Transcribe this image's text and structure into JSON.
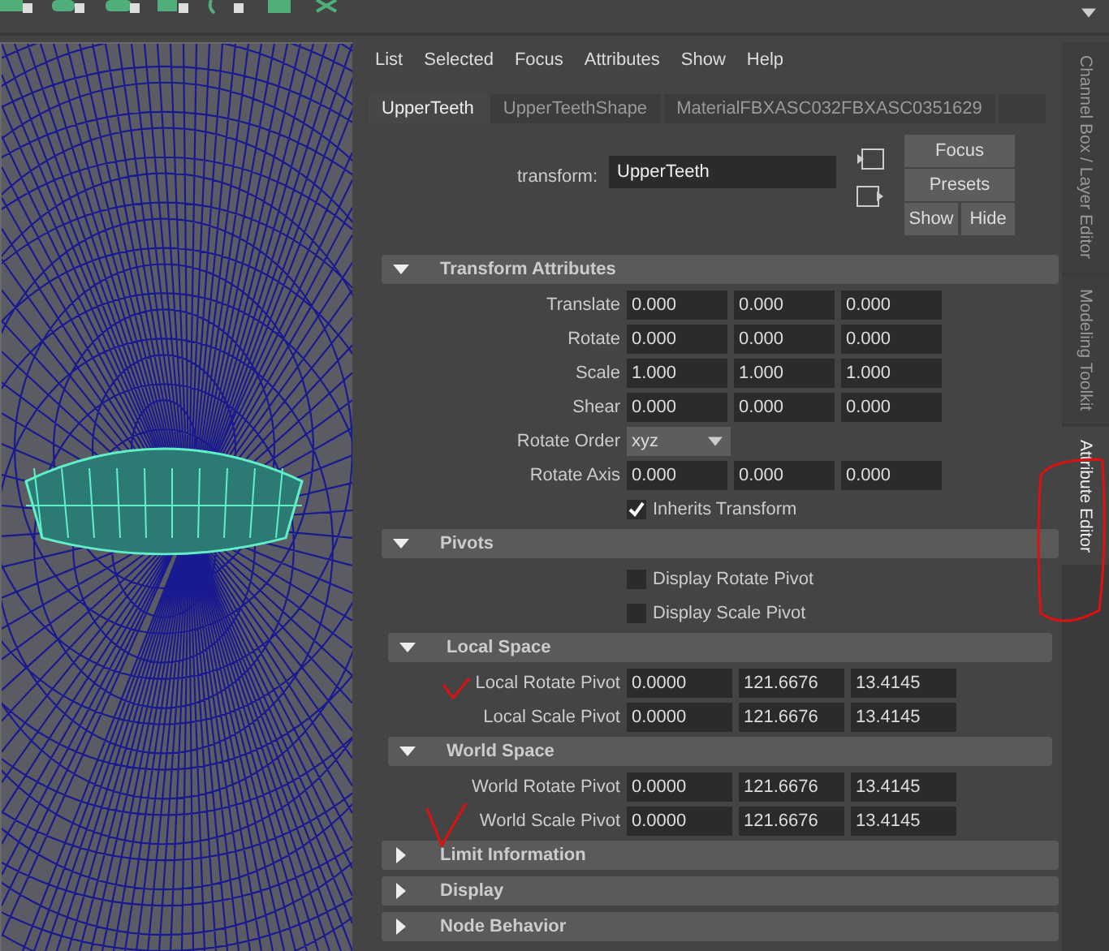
{
  "menu": [
    "List",
    "Selected",
    "Focus",
    "Attributes",
    "Show",
    "Help"
  ],
  "tabs": [
    {
      "label": "UpperTeeth",
      "selected": true
    },
    {
      "label": "UpperTeethShape",
      "selected": false
    },
    {
      "label": "MaterialFBXASC032FBXASC0351629",
      "selected": false
    }
  ],
  "node": {
    "label": "transform:",
    "value": "UpperTeeth"
  },
  "buttons": [
    "Focus",
    "Presets",
    "Show",
    "Hide"
  ],
  "sections": [
    {
      "title": "Transform Attributes",
      "expanded": true,
      "rows": [
        {
          "kind": "vector",
          "label": "Translate",
          "values": [
            "0.000",
            "0.000",
            "0.000"
          ]
        },
        {
          "kind": "vector",
          "label": "Rotate",
          "values": [
            "0.000",
            "0.000",
            "0.000"
          ]
        },
        {
          "kind": "vector",
          "label": "Scale",
          "values": [
            "1.000",
            "1.000",
            "1.000"
          ]
        },
        {
          "kind": "vector",
          "label": "Shear",
          "values": [
            "0.000",
            "0.000",
            "0.000"
          ]
        },
        {
          "kind": "dropdown",
          "label": "Rotate Order",
          "value": "xyz"
        },
        {
          "kind": "vector",
          "label": "Rotate Axis",
          "values": [
            "0.000",
            "0.000",
            "0.000"
          ]
        },
        {
          "kind": "checkbox",
          "label": "Inherits Transform",
          "checked": true
        }
      ]
    },
    {
      "title": "Pivots",
      "expanded": true,
      "rows": [
        {
          "kind": "checkbox",
          "label": "Display Rotate Pivot",
          "checked": false
        },
        {
          "kind": "checkbox",
          "label": "Display Scale Pivot",
          "checked": false
        }
      ],
      "children": [
        {
          "title": "Local Space",
          "expanded": true,
          "rows": [
            {
              "kind": "vector",
              "label": "Local Rotate Pivot",
              "values": [
                "0.0000",
                "121.6676",
                "13.4145"
              ]
            },
            {
              "kind": "vector",
              "label": "Local Scale Pivot",
              "values": [
                "0.0000",
                "121.6676",
                "13.4145"
              ]
            }
          ]
        },
        {
          "title": "World Space",
          "expanded": true,
          "rows": [
            {
              "kind": "vector",
              "label": "World Rotate Pivot",
              "values": [
                "0.0000",
                "121.6676",
                "13.4145"
              ]
            },
            {
              "kind": "vector",
              "label": "World Scale Pivot",
              "values": [
                "0.0000",
                "121.6676",
                "13.4145"
              ]
            }
          ]
        }
      ]
    },
    {
      "title": "Limit Information",
      "expanded": false
    },
    {
      "title": "Display",
      "expanded": false
    },
    {
      "title": "Node Behavior",
      "expanded": false
    }
  ],
  "side_tabs": [
    {
      "label": "Channel Box / Layer Editor",
      "selected": false
    },
    {
      "label": "Modeling Toolkit",
      "selected": false
    },
    {
      "label": "Attribute Editor",
      "selected": true
    }
  ]
}
